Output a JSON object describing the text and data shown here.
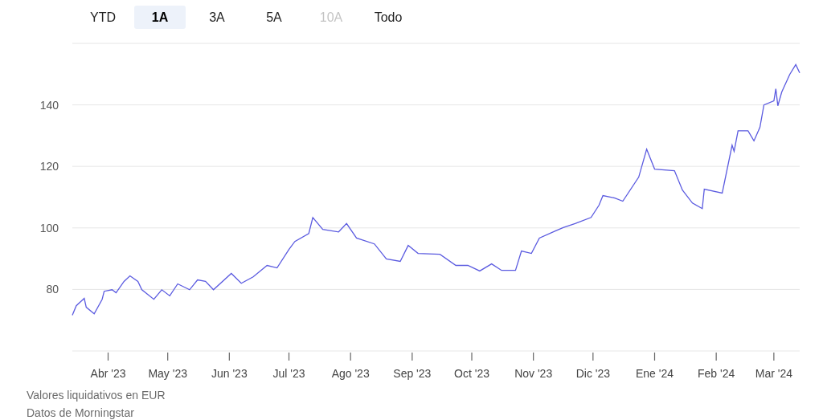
{
  "range_buttons": [
    {
      "label": "YTD",
      "selected": false,
      "disabled": false
    },
    {
      "label": "1A",
      "selected": true,
      "disabled": false
    },
    {
      "label": "3A",
      "selected": false,
      "disabled": false
    },
    {
      "label": "5A",
      "selected": false,
      "disabled": false
    },
    {
      "label": "10A",
      "selected": false,
      "disabled": true
    },
    {
      "label": "Todo",
      "selected": false,
      "disabled": false
    }
  ],
  "chart": {
    "chart_data": {
      "type": "line",
      "grid": true,
      "xlim": [
        "2023-03-14",
        "2024-03-14"
      ],
      "ylim": [
        60,
        160
      ],
      "yticks": [
        80,
        100,
        120,
        140
      ],
      "xticks": [
        {
          "value": "2023-04-01",
          "label": "Abr '23"
        },
        {
          "value": "2023-05-01",
          "label": "May '23"
        },
        {
          "value": "2023-06-01",
          "label": "Jun '23"
        },
        {
          "value": "2023-07-01",
          "label": "Jul '23"
        },
        {
          "value": "2023-08-01",
          "label": "Ago '23"
        },
        {
          "value": "2023-09-01",
          "label": "Sep '23"
        },
        {
          "value": "2023-10-01",
          "label": "Oct '23"
        },
        {
          "value": "2023-11-01",
          "label": "Nov '23"
        },
        {
          "value": "2023-12-01",
          "label": "Dic '23"
        },
        {
          "value": "2024-01-01",
          "label": "Ene '24"
        },
        {
          "value": "2024-02-01",
          "label": "Feb '24"
        },
        {
          "value": "2024-03-01",
          "label": "Mar '24"
        }
      ],
      "x": [
        "2023-03-14",
        "2023-03-16",
        "2023-03-20",
        "2023-03-21",
        "2023-03-25",
        "2023-03-29",
        "2023-03-30",
        "2023-04-03",
        "2023-04-05",
        "2023-04-09",
        "2023-04-12",
        "2023-04-16",
        "2023-04-18",
        "2023-04-24",
        "2023-04-28",
        "2023-05-02",
        "2023-05-06",
        "2023-05-12",
        "2023-05-16",
        "2023-05-20",
        "2023-05-24",
        "2023-06-02",
        "2023-06-07",
        "2023-06-13",
        "2023-06-20",
        "2023-06-25",
        "2023-07-01",
        "2023-07-04",
        "2023-07-11",
        "2023-07-13",
        "2023-07-18",
        "2023-07-26",
        "2023-07-30",
        "2023-08-04",
        "2023-08-13",
        "2023-08-19",
        "2023-08-26",
        "2023-08-30",
        "2023-09-04",
        "2023-09-15",
        "2023-09-23",
        "2023-09-29",
        "2023-10-05",
        "2023-10-11",
        "2023-10-16",
        "2023-10-23",
        "2023-10-26",
        "2023-10-31",
        "2023-11-04",
        "2023-11-12",
        "2023-11-16",
        "2023-11-22",
        "2023-11-30",
        "2023-12-04",
        "2023-12-06",
        "2023-12-12",
        "2023-12-16",
        "2023-12-24",
        "2023-12-28",
        "2024-01-01",
        "2024-01-11",
        "2024-01-15",
        "2024-01-20",
        "2024-01-25",
        "2024-01-26",
        "2024-02-04",
        "2024-02-09",
        "2024-02-10",
        "2024-02-12",
        "2024-02-17",
        "2024-02-20",
        "2024-02-23",
        "2024-02-25",
        "2024-03-01",
        "2024-03-02",
        "2024-03-03",
        "2024-03-05",
        "2024-03-09",
        "2024-03-12",
        "2024-03-14"
      ],
      "series": [
        {
          "color": "#5b5be0",
          "values": [
            71.6,
            74.7,
            77.1,
            74.2,
            72.1,
            76.8,
            79.4,
            79.9,
            78.9,
            82.6,
            84.4,
            82.6,
            79.9,
            76.8,
            79.9,
            77.9,
            81.8,
            79.9,
            83.1,
            82.6,
            79.9,
            85.2,
            82.0,
            84.1,
            87.8,
            87.0,
            93.0,
            95.6,
            98.2,
            103.4,
            99.5,
            98.7,
            101.4,
            96.7,
            94.8,
            89.9,
            89.1,
            94.3,
            91.7,
            91.4,
            87.8,
            87.8,
            86.0,
            88.3,
            86.2,
            86.2,
            92.5,
            91.7,
            96.7,
            99.0,
            100.1,
            101.4,
            103.4,
            107.4,
            110.5,
            109.7,
            108.7,
            116.5,
            125.6,
            119.1,
            118.6,
            112.3,
            108.1,
            106.3,
            112.6,
            111.3,
            126.9,
            124.9,
            131.6,
            131.6,
            128.3,
            132.7,
            140.0,
            141.3,
            145.2,
            139.7,
            144.2,
            149.9,
            153.1,
            150.4
          ]
        }
      ]
    }
  },
  "footer": [
    "Valores liquidativos en EUR",
    "Datos de Morningstar"
  ]
}
